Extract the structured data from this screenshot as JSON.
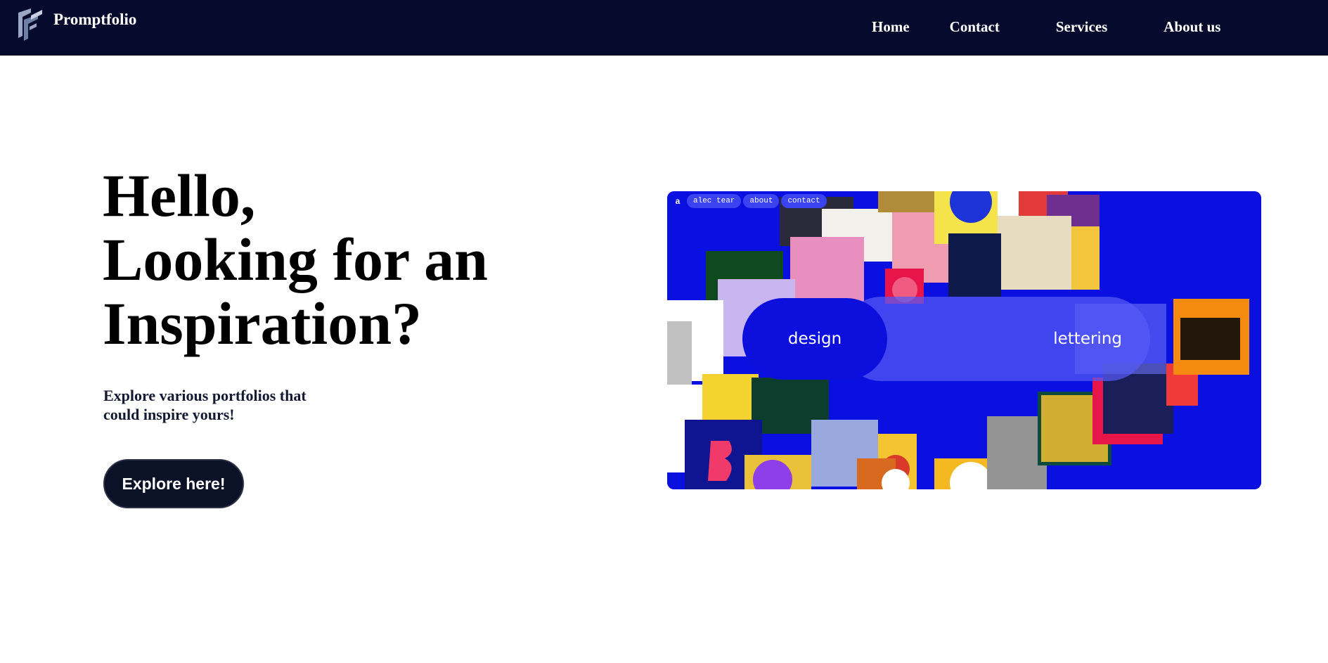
{
  "navbar": {
    "brand": "Promptfolio",
    "links": [
      "Home",
      "Contact",
      "Services",
      "About us"
    ],
    "background": "#060a2c"
  },
  "hero": {
    "title_lines": [
      "Hello,",
      "Looking for an",
      "Inspiration?"
    ],
    "subtitle_lines": [
      "Explore various portfolios that",
      "could inspire yours!"
    ],
    "cta_label": "Explore here!"
  },
  "showcase": {
    "mini_nav": {
      "logo": "a",
      "items": [
        "alec tear",
        "about",
        "contact"
      ]
    },
    "design_label": "design",
    "lettering_label": "lettering",
    "accent": "#0a10e0"
  }
}
